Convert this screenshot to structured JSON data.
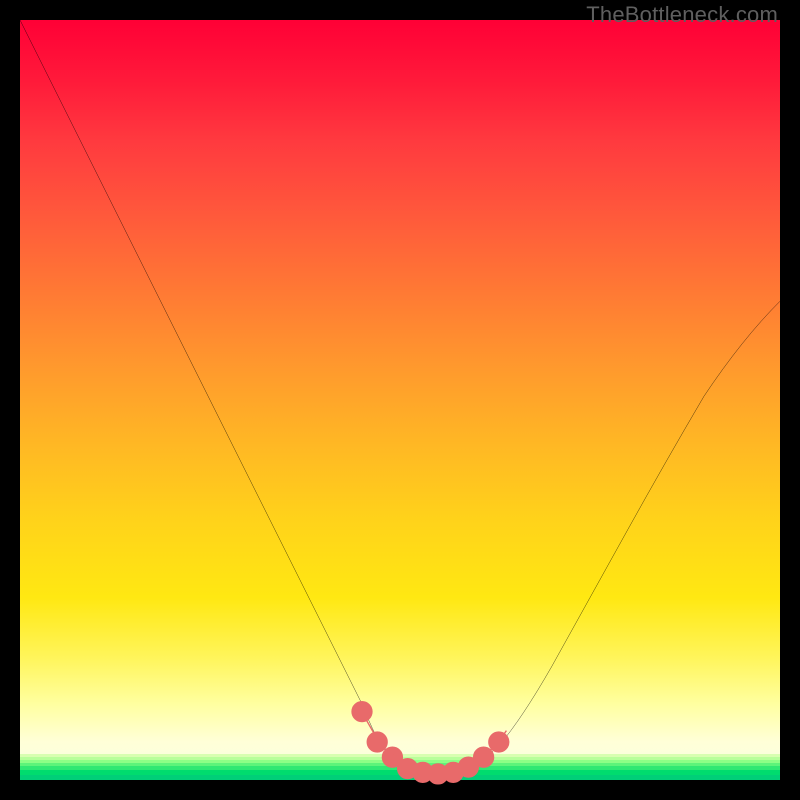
{
  "watermark": "TheBottleneck.com",
  "chart_data": {
    "type": "line",
    "title": "",
    "xlabel": "",
    "ylabel": "",
    "xlim": [
      0,
      100
    ],
    "ylim": [
      0,
      100
    ],
    "series": [
      {
        "name": "bottleneck-curve",
        "x": [
          0,
          5,
          10,
          15,
          20,
          25,
          30,
          35,
          40,
          45,
          48,
          50,
          52,
          55,
          58,
          60,
          63,
          66,
          70,
          75,
          80,
          85,
          90,
          95,
          100
        ],
        "values": [
          100,
          90,
          80,
          70,
          60,
          50,
          40,
          30,
          20,
          10,
          4,
          2,
          1,
          1,
          1,
          2,
          4,
          8,
          15,
          24,
          33,
          42,
          51,
          58,
          63
        ]
      }
    ],
    "highlight_segment": {
      "x": [
        45,
        47,
        49,
        51,
        53,
        55,
        57,
        59,
        61,
        63
      ],
      "values": [
        9,
        5,
        3,
        2,
        1,
        1,
        1,
        2,
        3,
        6
      ]
    },
    "gradient_color_stops": {
      "top": "#ff0036",
      "mid1": "#ff7a34",
      "mid2": "#ffd31a",
      "low": "#ffffd8",
      "bottom_band": "#00e060"
    }
  }
}
